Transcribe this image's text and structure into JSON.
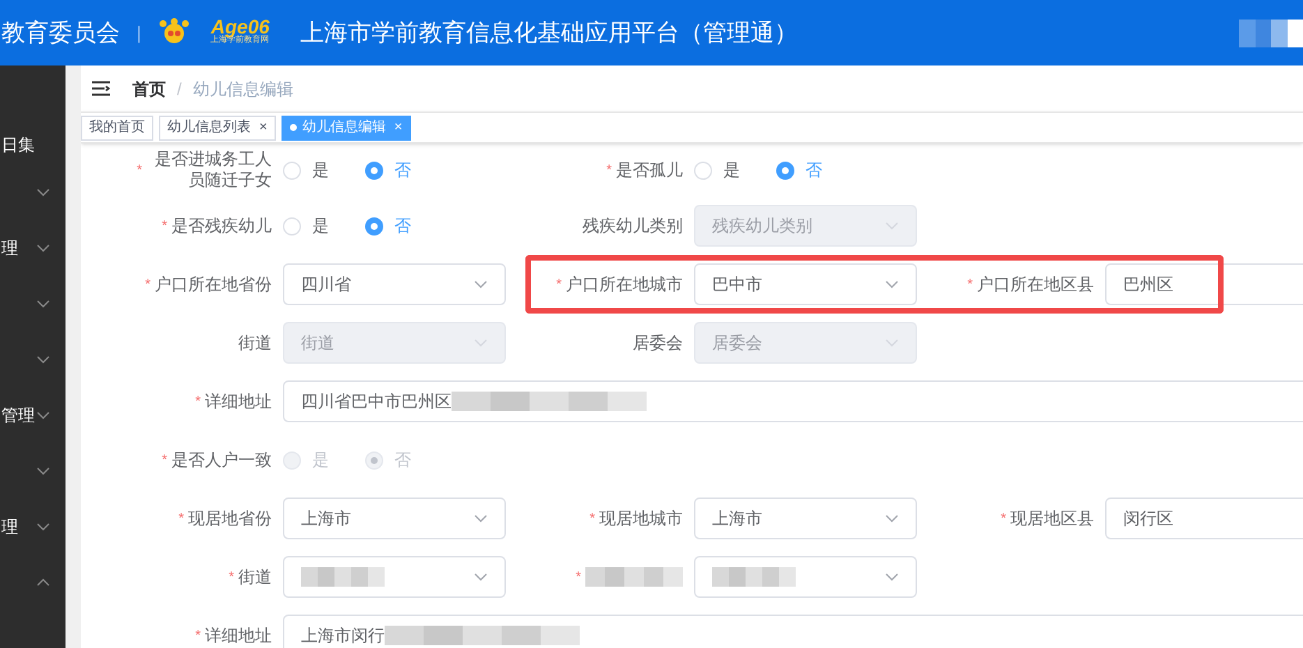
{
  "header": {
    "org": "教育委员会",
    "separator": "|",
    "logo_text": "Age06",
    "logo_subtext": "上海学前教育网",
    "title": "上海市学前教育信息化基础应用平台（管理通）",
    "user_redacted": true
  },
  "sidebar": {
    "current": "日集",
    "items": [
      {
        "expanded": false
      },
      {
        "label": "理",
        "expanded": false
      },
      {
        "expanded": false
      },
      {
        "expanded": false
      },
      {
        "label": "管理",
        "expanded": false
      },
      {
        "expanded": false
      },
      {
        "label": "理",
        "expanded": false
      },
      {
        "expanded": true
      }
    ]
  },
  "required_mark": "*",
  "close_mark": "×",
  "breadcrumb": [
    {
      "label": "首页",
      "current": false
    },
    {
      "label": "幼儿信息编辑",
      "current": true
    }
  ],
  "breadcrumb_separator": "/",
  "tabs": [
    {
      "label": "我的首页",
      "closable": false,
      "selected": false
    },
    {
      "label": "幼儿信息列表",
      "closable": true,
      "selected": false
    },
    {
      "label": "幼儿信息编辑",
      "closable": true,
      "selected": true
    }
  ],
  "form": {
    "rows": [
      {
        "fields": [
          {
            "kind": "radio",
            "label": "是否进城务工人员随迁子女",
            "required": true,
            "disabled": false,
            "options": [
              {
                "label": "是",
                "selected": false
              },
              {
                "label": "否",
                "selected": true
              }
            ]
          },
          {
            "kind": "radio",
            "label": "是否孤儿",
            "required": true,
            "disabled": false,
            "options": [
              {
                "label": "是",
                "selected": false
              },
              {
                "label": "否",
                "selected": true
              }
            ]
          }
        ]
      },
      {
        "fields": [
          {
            "kind": "radio",
            "label": "是否残疾幼儿",
            "required": true,
            "disabled": false,
            "options": [
              {
                "label": "是",
                "selected": false
              },
              {
                "label": "否",
                "selected": true
              }
            ]
          },
          {
            "kind": "select",
            "label": "残疾幼儿类别",
            "required": false,
            "disabled": true,
            "placeholder": "残疾幼儿类别"
          }
        ]
      },
      {
        "fields": [
          {
            "kind": "select",
            "label": "户口所在地省份",
            "required": true,
            "disabled": false,
            "value": "四川省"
          },
          {
            "kind": "select",
            "label": "户口所在地城市",
            "required": true,
            "disabled": false,
            "value": "巴中市",
            "highlighted": true
          },
          {
            "kind": "input",
            "label": "户口所在地区县",
            "required": true,
            "disabled": false,
            "value": "巴州区",
            "highlighted": true
          }
        ]
      },
      {
        "fields": [
          {
            "kind": "select",
            "label": "街道",
            "required": false,
            "disabled": true,
            "placeholder": "街道"
          },
          {
            "kind": "select",
            "label": "居委会",
            "required": false,
            "disabled": true,
            "placeholder": "居委会"
          }
        ]
      },
      {
        "fields": [
          {
            "kind": "wide-input",
            "label": "详细地址",
            "required": true,
            "disabled": false,
            "value": "四川省巴中市巴州区",
            "redacted": true
          }
        ]
      },
      {
        "fields": [
          {
            "kind": "radio",
            "label": "是否人户一致",
            "required": true,
            "disabled": true,
            "options": [
              {
                "label": "是",
                "selected": false
              },
              {
                "label": "否",
                "selected": true
              }
            ]
          }
        ]
      },
      {
        "fields": [
          {
            "kind": "select",
            "label": "现居地省份",
            "required": true,
            "disabled": false,
            "value": "上海市"
          },
          {
            "kind": "select",
            "label": "现居地城市",
            "required": true,
            "disabled": false,
            "value": "上海市"
          },
          {
            "kind": "input",
            "label": "现居地区县",
            "required": true,
            "disabled": false,
            "value": "闵行区"
          }
        ]
      },
      {
        "fields": [
          {
            "kind": "select",
            "label": "街道",
            "required": true,
            "disabled": false,
            "redacted": true
          },
          {
            "kind": "select",
            "required": true,
            "disabled": false,
            "redacted": true,
            "label_redacted": true
          }
        ]
      },
      {
        "fields": [
          {
            "kind": "wide-input",
            "label": "详细地址",
            "required": true,
            "disabled": false,
            "value": "上海市闵行",
            "redacted": true
          }
        ]
      }
    ]
  }
}
